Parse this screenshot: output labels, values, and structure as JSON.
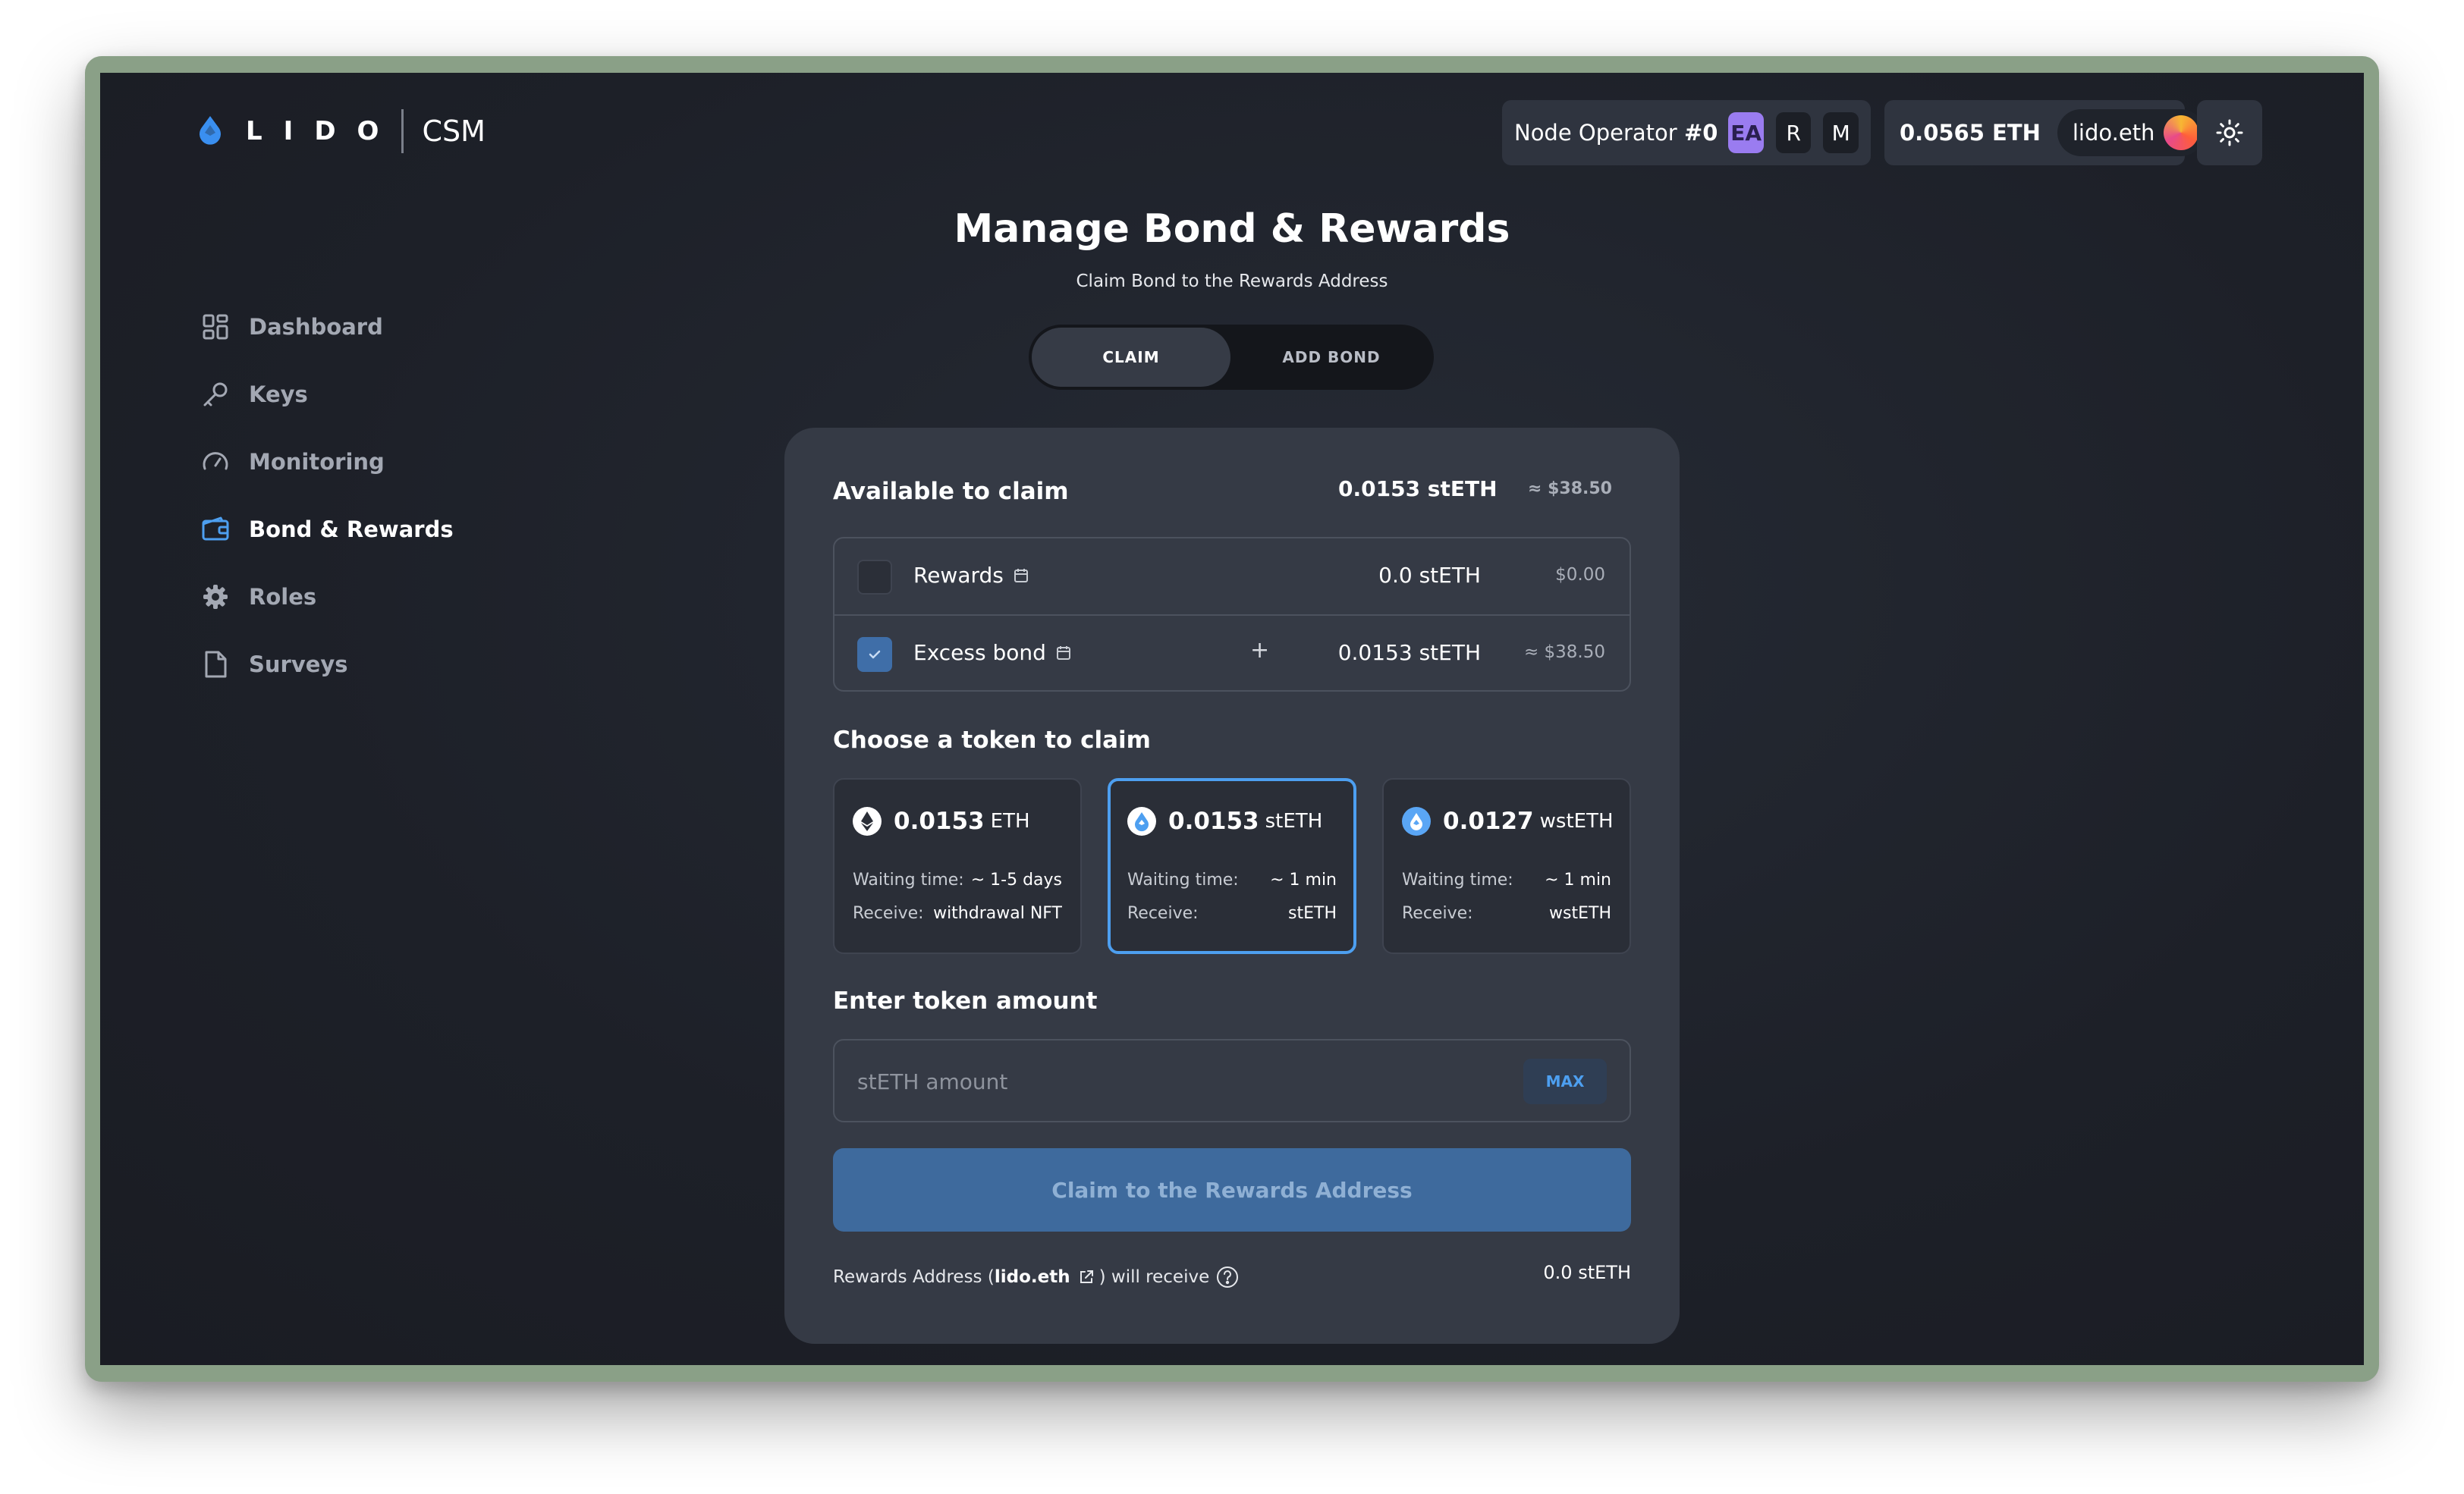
{
  "logo": {
    "brand": "LIDO",
    "product": "CSM"
  },
  "header": {
    "operator_prefix": "Node Operator ",
    "operator_id": "#0",
    "roles": [
      "EA",
      "R",
      "M"
    ],
    "balance": "0.0565 ETH",
    "ens_name": "lido.eth"
  },
  "sidebar": {
    "items": [
      {
        "label": "Dashboard",
        "icon": "dashboard-icon"
      },
      {
        "label": "Keys",
        "icon": "key-icon"
      },
      {
        "label": "Monitoring",
        "icon": "gauge-icon"
      },
      {
        "label": "Bond & Rewards",
        "icon": "wallet-icon",
        "active": true
      },
      {
        "label": "Roles",
        "icon": "gear-icon"
      },
      {
        "label": "Surveys",
        "icon": "document-icon"
      }
    ]
  },
  "page": {
    "title": "Manage Bond & Rewards",
    "subtitle": "Claim Bond to the Rewards Address",
    "tabs": [
      "CLAIM",
      "ADD BOND"
    ]
  },
  "available": {
    "title": "Available to claim",
    "amount": "0.0153 stETH",
    "usd": "≈ $38.50",
    "rows": [
      {
        "label": "Rewards",
        "amount": "0.0 stETH",
        "usd": "$0.00",
        "checked": false
      },
      {
        "label": "Excess bond",
        "prefix": "+",
        "amount": "0.0153 stETH",
        "usd": "≈ $38.50",
        "checked": true
      }
    ]
  },
  "tokens": {
    "title": "Choose a token to claim",
    "waiting_label": "Waiting time:",
    "receive_label": "Receive:",
    "options": [
      {
        "amount": "0.0153",
        "unit": "ETH",
        "waiting": "~ 1-5 days",
        "receive": "withdrawal NFT",
        "selected": false
      },
      {
        "amount": "0.0153",
        "unit": "stETH",
        "waiting": "~ 1 min",
        "receive": "stETH",
        "selected": true
      },
      {
        "amount": "0.0127",
        "unit": "wstETH",
        "waiting": "~ 1 min",
        "receive": "wstETH",
        "selected": false
      }
    ]
  },
  "amount_section": {
    "title": "Enter token amount",
    "placeholder": "stETH amount",
    "max_label": "MAX"
  },
  "claim_button": "Claim to the Rewards Address",
  "footer": {
    "prefix": "Rewards Address (",
    "address": "lido.eth",
    "suffix": ") will receive",
    "amount": "0.0 stETH"
  },
  "colors": {
    "accent": "#4d9ff0",
    "claim_button": "#3e6a9d",
    "role_ea": "#9a7cf0"
  }
}
